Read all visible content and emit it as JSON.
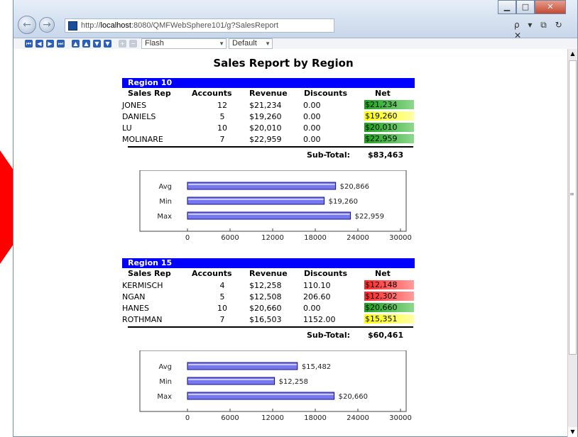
{
  "browser": {
    "address_prefix": "http://",
    "address_host": "localhost",
    "address_rest": ":8080/QMFWebSphere101/g?SalesReport",
    "search_glyphs": "ρ ▾ ⧉ ↻ ✕"
  },
  "toolbar": {
    "format_select": "Flash",
    "style_select": "Default"
  },
  "report": {
    "title": "Sales Report by Region",
    "headers": {
      "rep": "Sales Rep",
      "accounts": "Accounts",
      "revenue": "Revenue",
      "discounts": "Discounts",
      "net": "Net"
    },
    "subtotal_label": "Sub-Total:",
    "regions": [
      {
        "name": "Region 10",
        "rows": [
          {
            "rep": "JONES",
            "accounts": "12",
            "revenue": "$21,234",
            "discounts": "0.00",
            "net": "$21,234",
            "status": "green"
          },
          {
            "rep": "DANIELS",
            "accounts": "5",
            "revenue": "$19,260",
            "discounts": "0.00",
            "net": "$19,260",
            "status": "yellow"
          },
          {
            "rep": "LU",
            "accounts": "10",
            "revenue": "$20,010",
            "discounts": "0.00",
            "net": "$20,010",
            "status": "green"
          },
          {
            "rep": "MOLINARE",
            "accounts": "7",
            "revenue": "$22,959",
            "discounts": "0.00",
            "net": "$22,959",
            "status": "green"
          }
        ],
        "subtotal": "$83,463"
      },
      {
        "name": "Region 15",
        "rows": [
          {
            "rep": "KERMISCH",
            "accounts": "4",
            "revenue": "$12,258",
            "discounts": "110.10",
            "net": "$12,148",
            "status": "red"
          },
          {
            "rep": "NGAN",
            "accounts": "5",
            "revenue": "$12,508",
            "discounts": "206.60",
            "net": "$12,302",
            "status": "red"
          },
          {
            "rep": "HANES",
            "accounts": "10",
            "revenue": "$20,660",
            "discounts": "0.00",
            "net": "$20,660",
            "status": "green"
          },
          {
            "rep": "ROTHMAN",
            "accounts": "7",
            "revenue": "$16,503",
            "discounts": "1152.00",
            "net": "$15,351",
            "status": "yellow"
          }
        ],
        "subtotal": "$60,461"
      }
    ]
  },
  "colors": {
    "region_bar": "#0000ff",
    "green": "#18a318",
    "yellow": "#ffff00",
    "red": "#ff2424",
    "bar": "#5555dd"
  },
  "chart_data": [
    {
      "type": "bar",
      "orientation": "horizontal",
      "categories": [
        "Avg",
        "Min",
        "Max"
      ],
      "values": [
        20866,
        19260,
        22959
      ],
      "labels": [
        "$20,866",
        "$19,260",
        "$22,959"
      ],
      "xlim": [
        0,
        30000
      ],
      "xticks": [
        "0",
        "6000",
        "12000",
        "18000",
        "24000",
        "30000"
      ],
      "grid": false
    },
    {
      "type": "bar",
      "orientation": "horizontal",
      "categories": [
        "Avg",
        "Min",
        "Max"
      ],
      "values": [
        15482,
        12258,
        20660
      ],
      "labels": [
        "$15,482",
        "$12,258",
        "$20,660"
      ],
      "xlim": [
        0,
        30000
      ],
      "xticks": [
        "0",
        "6000",
        "12000",
        "18000",
        "24000",
        "30000"
      ],
      "grid": false
    }
  ]
}
